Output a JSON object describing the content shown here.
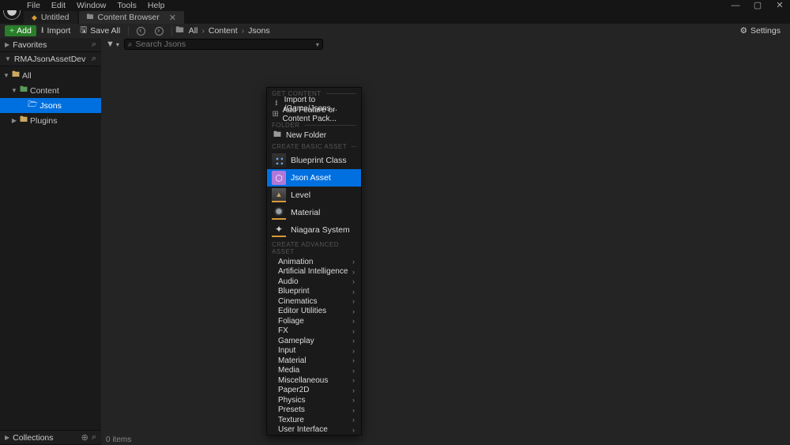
{
  "menubar": {
    "items": [
      "File",
      "Edit",
      "Window",
      "Tools",
      "Help"
    ]
  },
  "tabs": {
    "level": {
      "label": "Untitled"
    },
    "browser": {
      "label": "Content Browser"
    }
  },
  "toolbar": {
    "add": "Add",
    "import": "Import",
    "save_all": "Save All",
    "settings": "Settings"
  },
  "breadcrumb": {
    "root": "All",
    "parts": [
      "Content",
      "Jsons"
    ]
  },
  "sidebar": {
    "favorites": "Favorites",
    "project": "RMAJsonAssetDev",
    "tree": {
      "all": "All",
      "content": "Content",
      "jsons": "Jsons",
      "plugins": "Plugins"
    },
    "collections": "Collections"
  },
  "search": {
    "placeholder": "Search Jsons"
  },
  "status": {
    "items": "0 items"
  },
  "ctx": {
    "sections": {
      "get_content": "GET CONTENT",
      "folder": "FOLDER",
      "basic": "CREATE BASIC ASSET",
      "advanced": "CREATE ADVANCED ASSET"
    },
    "import_to": "Import to /Game/Jsons...",
    "add_feature": "Add Feature or Content Pack...",
    "new_folder": "New Folder",
    "basic_items": {
      "blueprint": "Blueprint Class",
      "json": "Json Asset",
      "level": "Level",
      "material": "Material",
      "niagara": "Niagara System"
    },
    "advanced_items": [
      "Animation",
      "Artificial Intelligence",
      "Audio",
      "Blueprint",
      "Cinematics",
      "Editor Utilities",
      "Foliage",
      "FX",
      "Gameplay",
      "Input",
      "Material",
      "Media",
      "Miscellaneous",
      "Paper2D",
      "Physics",
      "Presets",
      "Texture",
      "User Interface"
    ]
  }
}
